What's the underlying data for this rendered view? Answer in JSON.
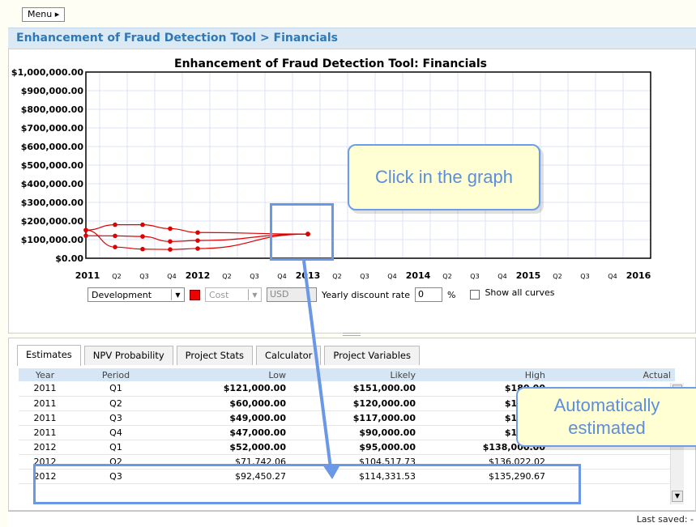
{
  "menu_label": "Menu ▸",
  "breadcrumb": "Enhancement of Fraud Detection Tool > Financials",
  "chart_data": {
    "type": "line",
    "title": "Enhancement of Fraud Detection Tool: Financials",
    "ylim": [
      0,
      1000000
    ],
    "y_ticks": [
      "$0.00",
      "$100,000.00",
      "$200,000.00",
      "$300,000.00",
      "$400,000.00",
      "$500,000.00",
      "$600,000.00",
      "$700,000.00",
      "$800,000.00",
      "$900,000.00",
      "$1,000,000.00"
    ],
    "x_ticks": [
      "2011",
      "Q2",
      "Q3",
      "Q4",
      "2012",
      "Q2",
      "Q3",
      "Q4",
      "2013",
      "Q2",
      "Q3",
      "Q4",
      "2014",
      "Q2",
      "Q3",
      "Q4",
      "2015",
      "Q2",
      "Q3",
      "Q4",
      "2016"
    ],
    "x_tick_bold": [
      true,
      false,
      false,
      false,
      true,
      false,
      false,
      false,
      true,
      false,
      false,
      false,
      true,
      false,
      false,
      false,
      true,
      false,
      false,
      false,
      true
    ],
    "x": [
      0,
      1,
      2,
      3,
      4,
      8
    ],
    "series": [
      {
        "values": [
          151000,
          180000,
          180000,
          159000,
          138000,
          130000
        ]
      },
      {
        "values": [
          121000,
          120000,
          117000,
          90000,
          95000,
          130000
        ]
      },
      {
        "values": [
          151000,
          60000,
          49000,
          47000,
          52000,
          130000
        ]
      }
    ],
    "grid": true,
    "line_color": "#e00000"
  },
  "controls": {
    "phase": "Development",
    "metric": "Cost",
    "currency": "USD",
    "discount_label": "Yearly discount rate",
    "discount_value": "0",
    "percent": "%",
    "show_all_label": "Show all curves"
  },
  "tabs": [
    "Estimates",
    "NPV Probability",
    "Project Stats",
    "Calculator",
    "Project Variables"
  ],
  "table": {
    "headers": {
      "year": "Year",
      "period": "Period",
      "low": "Low",
      "likely": "Likely",
      "high": "High",
      "actual": "Actual"
    },
    "rows": [
      {
        "year": "2011",
        "period": "Q1",
        "low": "$121,000.00",
        "likely": "$151,000.00",
        "high": "$180,00"
      },
      {
        "year": "2011",
        "period": "Q2",
        "low": "$60,000.00",
        "likely": "$120,000.00",
        "high": "$190,00"
      },
      {
        "year": "2011",
        "period": "Q3",
        "low": "$49,000.00",
        "likely": "$117,000.00",
        "high": "$190,00"
      },
      {
        "year": "2011",
        "period": "Q4",
        "low": "$47,000.00",
        "likely": "$90,000.00",
        "high": "$159,00"
      },
      {
        "year": "2012",
        "period": "Q1",
        "low": "$52,000.00",
        "likely": "$95,000.00",
        "high": "$138,000.00"
      },
      {
        "year": "2012",
        "period": "Q2",
        "low": "$71,742.06",
        "likely": "$104,517.73",
        "high": "$136,022.02"
      },
      {
        "year": "2012",
        "period": "Q3",
        "low": "$92,450.27",
        "likely": "$114,331.53",
        "high": "$135,290.67"
      }
    ]
  },
  "status": "Last saved: -",
  "annotations": {
    "click_graph": "Click in the graph",
    "auto_estimated_line1": "Automatically",
    "auto_estimated_line2": "estimated"
  },
  "colors": {
    "accent_blue": "#6a98e6",
    "callout_bg": "#ffffd3",
    "breadcrumb_text": "#2f78b7",
    "curve": "#e00000"
  }
}
